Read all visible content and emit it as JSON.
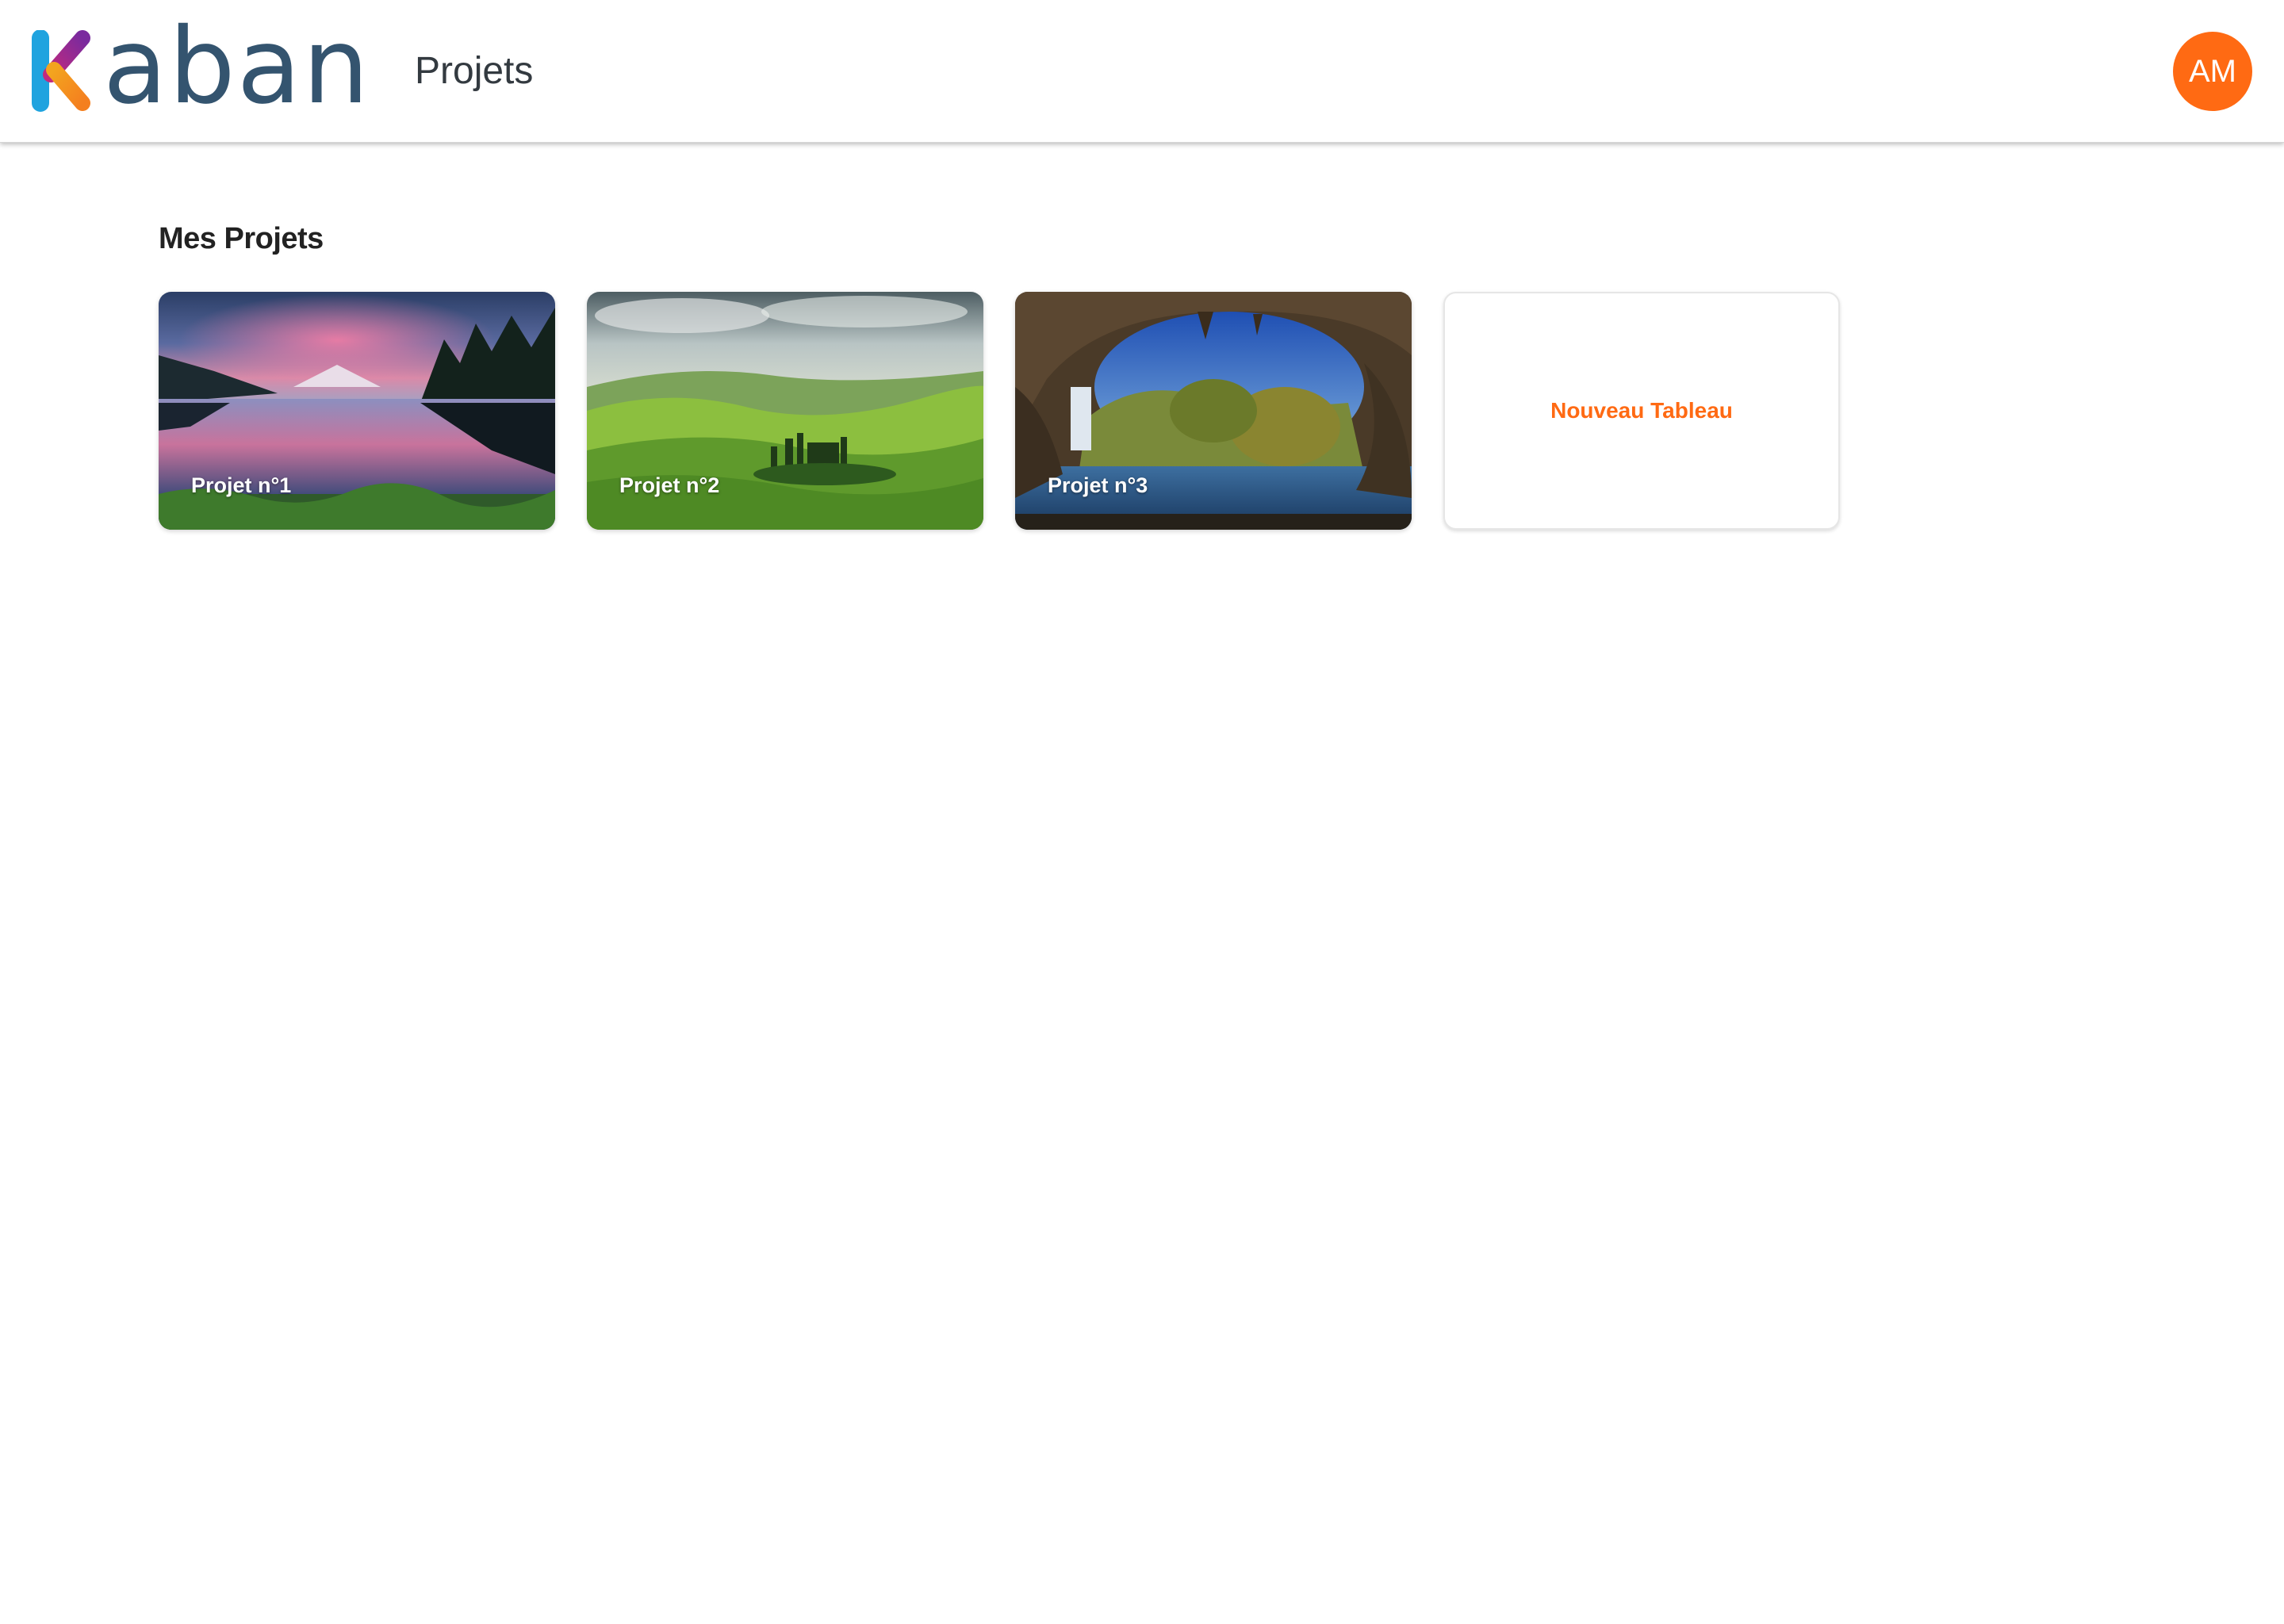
{
  "header": {
    "logo_text": "aban",
    "logo_letter": "K",
    "nav_title": "Projets",
    "avatar_initials": "AM"
  },
  "main": {
    "section_title": "Mes Projets",
    "projects": [
      {
        "label": "Projet n°1",
        "image": "mountain-lake-sunset"
      },
      {
        "label": "Projet n°2",
        "image": "green-rolling-hills"
      },
      {
        "label": "Projet n°3",
        "image": "cave-waterfall-lagoon"
      }
    ],
    "new_board_label": "Nouveau Tableau"
  },
  "colors": {
    "accent": "#ff6a13",
    "logo_text": "#34546f",
    "logo_k_blue": "#1fa3df",
    "logo_k_purple": "#8a2a9a",
    "logo_k_orange": "#f79a1e"
  }
}
